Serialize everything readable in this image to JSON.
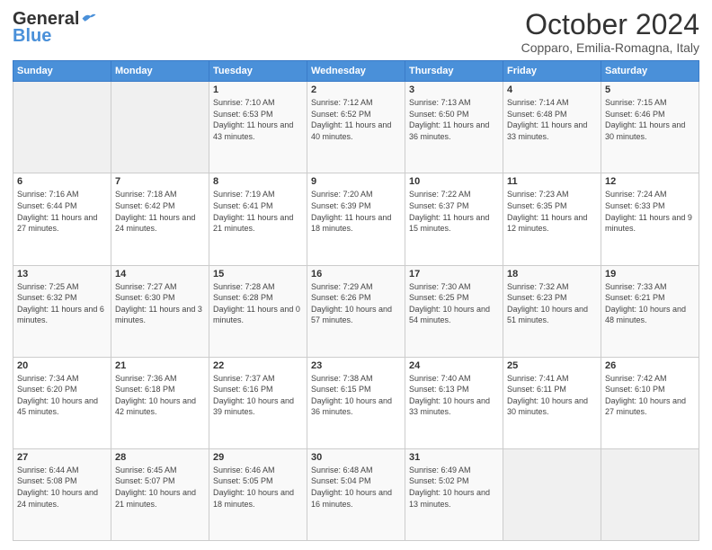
{
  "header": {
    "logo_general": "General",
    "logo_blue": "Blue",
    "title": "October 2024",
    "subtitle": "Copparo, Emilia-Romagna, Italy"
  },
  "weekdays": [
    "Sunday",
    "Monday",
    "Tuesday",
    "Wednesday",
    "Thursday",
    "Friday",
    "Saturday"
  ],
  "weeks": [
    [
      {
        "day": "",
        "empty": true
      },
      {
        "day": "",
        "empty": true
      },
      {
        "day": "1",
        "sunrise": "7:10 AM",
        "sunset": "6:53 PM",
        "daylight": "11 hours and 43 minutes."
      },
      {
        "day": "2",
        "sunrise": "7:12 AM",
        "sunset": "6:52 PM",
        "daylight": "11 hours and 40 minutes."
      },
      {
        "day": "3",
        "sunrise": "7:13 AM",
        "sunset": "6:50 PM",
        "daylight": "11 hours and 36 minutes."
      },
      {
        "day": "4",
        "sunrise": "7:14 AM",
        "sunset": "6:48 PM",
        "daylight": "11 hours and 33 minutes."
      },
      {
        "day": "5",
        "sunrise": "7:15 AM",
        "sunset": "6:46 PM",
        "daylight": "11 hours and 30 minutes."
      }
    ],
    [
      {
        "day": "6",
        "sunrise": "7:16 AM",
        "sunset": "6:44 PM",
        "daylight": "11 hours and 27 minutes."
      },
      {
        "day": "7",
        "sunrise": "7:18 AM",
        "sunset": "6:42 PM",
        "daylight": "11 hours and 24 minutes."
      },
      {
        "day": "8",
        "sunrise": "7:19 AM",
        "sunset": "6:41 PM",
        "daylight": "11 hours and 21 minutes."
      },
      {
        "day": "9",
        "sunrise": "7:20 AM",
        "sunset": "6:39 PM",
        "daylight": "11 hours and 18 minutes."
      },
      {
        "day": "10",
        "sunrise": "7:22 AM",
        "sunset": "6:37 PM",
        "daylight": "11 hours and 15 minutes."
      },
      {
        "day": "11",
        "sunrise": "7:23 AM",
        "sunset": "6:35 PM",
        "daylight": "11 hours and 12 minutes."
      },
      {
        "day": "12",
        "sunrise": "7:24 AM",
        "sunset": "6:33 PM",
        "daylight": "11 hours and 9 minutes."
      }
    ],
    [
      {
        "day": "13",
        "sunrise": "7:25 AM",
        "sunset": "6:32 PM",
        "daylight": "11 hours and 6 minutes."
      },
      {
        "day": "14",
        "sunrise": "7:27 AM",
        "sunset": "6:30 PM",
        "daylight": "11 hours and 3 minutes."
      },
      {
        "day": "15",
        "sunrise": "7:28 AM",
        "sunset": "6:28 PM",
        "daylight": "11 hours and 0 minutes."
      },
      {
        "day": "16",
        "sunrise": "7:29 AM",
        "sunset": "6:26 PM",
        "daylight": "10 hours and 57 minutes."
      },
      {
        "day": "17",
        "sunrise": "7:30 AM",
        "sunset": "6:25 PM",
        "daylight": "10 hours and 54 minutes."
      },
      {
        "day": "18",
        "sunrise": "7:32 AM",
        "sunset": "6:23 PM",
        "daylight": "10 hours and 51 minutes."
      },
      {
        "day": "19",
        "sunrise": "7:33 AM",
        "sunset": "6:21 PM",
        "daylight": "10 hours and 48 minutes."
      }
    ],
    [
      {
        "day": "20",
        "sunrise": "7:34 AM",
        "sunset": "6:20 PM",
        "daylight": "10 hours and 45 minutes."
      },
      {
        "day": "21",
        "sunrise": "7:36 AM",
        "sunset": "6:18 PM",
        "daylight": "10 hours and 42 minutes."
      },
      {
        "day": "22",
        "sunrise": "7:37 AM",
        "sunset": "6:16 PM",
        "daylight": "10 hours and 39 minutes."
      },
      {
        "day": "23",
        "sunrise": "7:38 AM",
        "sunset": "6:15 PM",
        "daylight": "10 hours and 36 minutes."
      },
      {
        "day": "24",
        "sunrise": "7:40 AM",
        "sunset": "6:13 PM",
        "daylight": "10 hours and 33 minutes."
      },
      {
        "day": "25",
        "sunrise": "7:41 AM",
        "sunset": "6:11 PM",
        "daylight": "10 hours and 30 minutes."
      },
      {
        "day": "26",
        "sunrise": "7:42 AM",
        "sunset": "6:10 PM",
        "daylight": "10 hours and 27 minutes."
      }
    ],
    [
      {
        "day": "27",
        "sunrise": "6:44 AM",
        "sunset": "5:08 PM",
        "daylight": "10 hours and 24 minutes."
      },
      {
        "day": "28",
        "sunrise": "6:45 AM",
        "sunset": "5:07 PM",
        "daylight": "10 hours and 21 minutes."
      },
      {
        "day": "29",
        "sunrise": "6:46 AM",
        "sunset": "5:05 PM",
        "daylight": "10 hours and 18 minutes."
      },
      {
        "day": "30",
        "sunrise": "6:48 AM",
        "sunset": "5:04 PM",
        "daylight": "10 hours and 16 minutes."
      },
      {
        "day": "31",
        "sunrise": "6:49 AM",
        "sunset": "5:02 PM",
        "daylight": "10 hours and 13 minutes."
      },
      {
        "day": "",
        "empty": true
      },
      {
        "day": "",
        "empty": true
      }
    ]
  ]
}
